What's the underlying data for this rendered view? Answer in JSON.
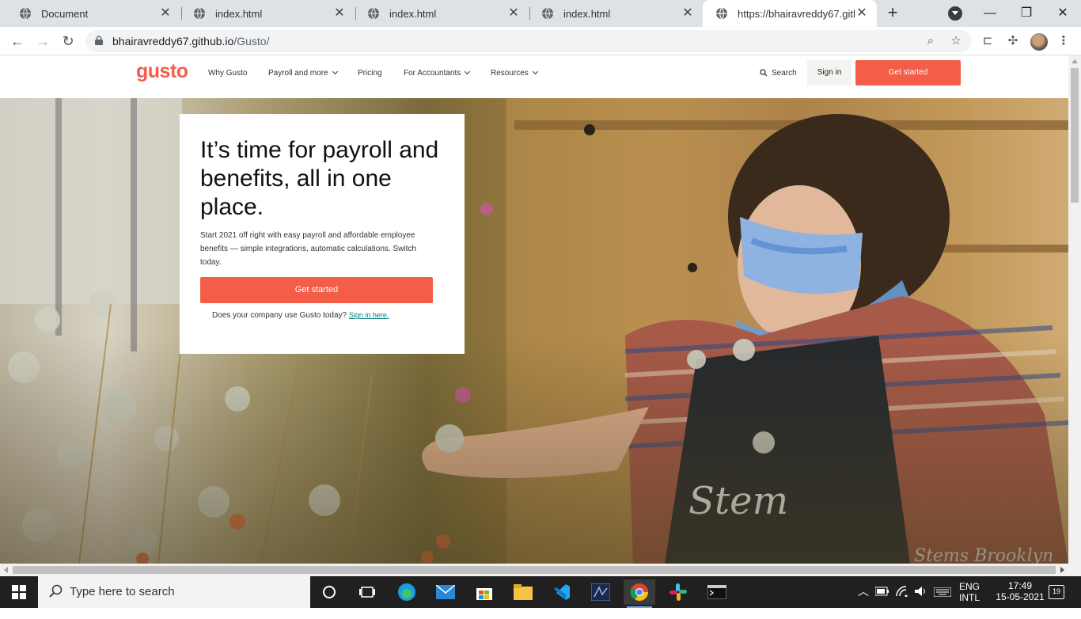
{
  "browser": {
    "tabs": [
      {
        "title": "Document"
      },
      {
        "title": "index.html"
      },
      {
        "title": "index.html"
      },
      {
        "title": "index.html"
      },
      {
        "title": "https://bhairavreddy67.github.io/Gusto/"
      }
    ],
    "new_tab_label": "+",
    "url_host": "bhairavreddy67.github.io",
    "url_path": "/Gusto/"
  },
  "site": {
    "logo": "gusto",
    "nav": [
      {
        "label": "Why Gusto",
        "has_dropdown": false
      },
      {
        "label": "Payroll and more",
        "has_dropdown": true
      },
      {
        "label": "Pricing",
        "has_dropdown": false
      },
      {
        "label": "For Accountants",
        "has_dropdown": true
      },
      {
        "label": "Resources",
        "has_dropdown": true
      }
    ],
    "search_label": "Search",
    "signin_label": "Sign in",
    "cta_label": "Get started",
    "accent": "#f45d48"
  },
  "hero": {
    "title": "It’s time for payroll and benefits, all in one place.",
    "subtitle": "Start 2021 off right with easy payroll and affordable employee benefits — simple integrations, automatic calculations. Switch today.",
    "cta_label": "Get started",
    "note": "Does your company use Gusto today?",
    "note_link": "Sign in here."
  },
  "taskbar": {
    "search_placeholder": "Type here to search",
    "lang_top": "ENG",
    "lang_bottom": "INTL",
    "time": "17:49",
    "date": "15-05-2021",
    "notification_count": "19"
  }
}
